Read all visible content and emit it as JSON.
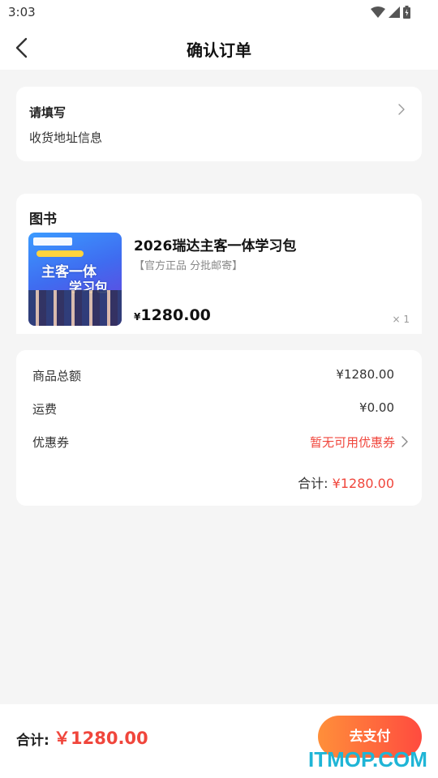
{
  "status_bar": {
    "time": "3:03"
  },
  "header": {
    "title": "确认订单"
  },
  "address": {
    "title": "请填写",
    "subtitle": "收货地址信息"
  },
  "book_section": {
    "title": "图书",
    "product": {
      "name": "2026瑞达主客一体学习包",
      "tag": "【官方正品 分批邮寄】",
      "price_symbol": "¥",
      "price": "1280.00",
      "quantity": "× 1",
      "cover_text_1": "主客一体",
      "cover_text_2": "学习包"
    }
  },
  "summary": {
    "goods_total_label": "商品总额",
    "goods_total_value": "¥1280.00",
    "shipping_label": "运费",
    "shipping_value": "¥0.00",
    "coupon_label": "优惠券",
    "coupon_value": "暂无可用优惠券",
    "total_label": "合计:",
    "total_value": "¥1280.00"
  },
  "bottom_bar": {
    "total_label": "合计:",
    "total_value": "￥1280.00",
    "pay_button": "去支付"
  },
  "watermark": "ITMOP.COM",
  "colors": {
    "accent_red": "#f0463c",
    "button_start": "#ff8f3a",
    "button_end": "#ff4b3f",
    "watermark": "#1fb5d6"
  },
  "icons": {
    "back": "chevron-left-icon",
    "chevron": "chevron-right-icon",
    "wifi": "wifi-icon",
    "signal": "signal-icon",
    "battery": "battery-icon"
  }
}
